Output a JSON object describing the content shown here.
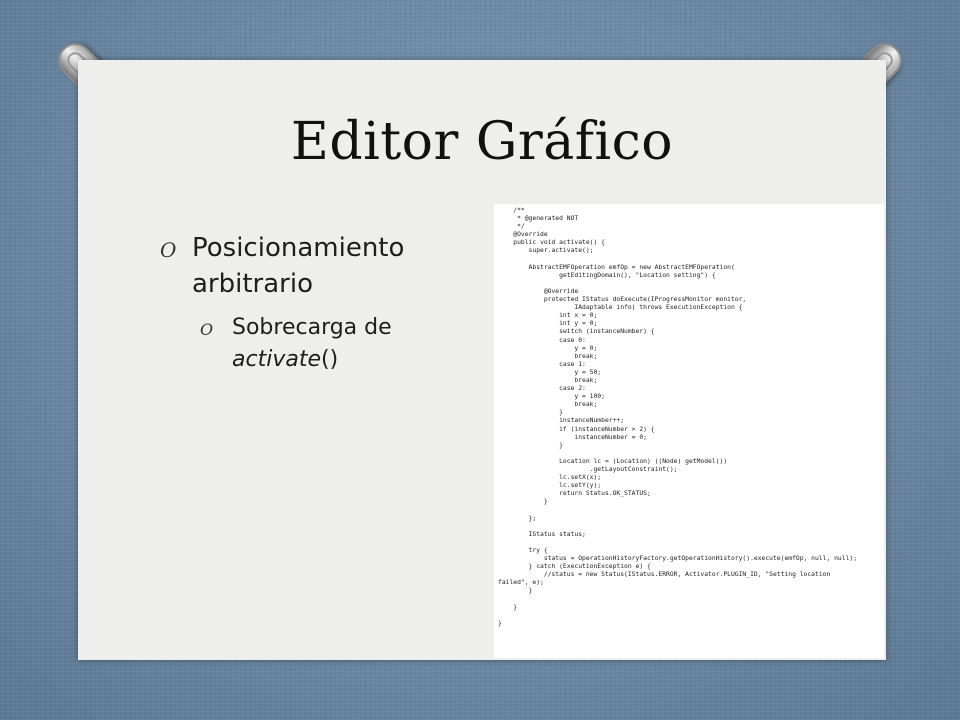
{
  "slide": {
    "title": "Editor Gráfico",
    "bullet_marker": "O",
    "bullets": [
      {
        "text": "Posicionamiento arbitrario"
      },
      {
        "prefix": "Sobrecarga de ",
        "emphasis": "activate",
        "suffix": "()"
      }
    ]
  },
  "code_screenshot": {
    "lines": [
      "    /**",
      "     * @generated NOT",
      "     */",
      "    @Override",
      "    public void activate() {",
      "        super.activate();",
      "",
      "        AbstractEMFOperation emfOp = new AbstractEMFOperation(",
      "                getEditingDomain(), \"Location setting\") {",
      "",
      "            @Override",
      "            protected IStatus doExecute(IProgressMonitor monitor,",
      "                    IAdaptable info) throws ExecutionException {",
      "                int x = 0;",
      "                int y = 0;",
      "                switch (instanceNumber) {",
      "                case 0:",
      "                    y = 0;",
      "                    break;",
      "                case 1:",
      "                    y = 50;",
      "                    break;",
      "                case 2:",
      "                    y = 100;",
      "                    break;",
      "                }",
      "                instanceNumber++;",
      "                if (instanceNumber > 2) {",
      "                    instanceNumber = 0;",
      "                }",
      "",
      "                Location lc = (Location) ((Node) getModel())",
      "                        .getLayoutConstraint();",
      "                lc.setX(x);",
      "                lc.setY(y);",
      "                return Status.OK_STATUS;",
      "            }",
      "",
      "        };",
      "",
      "        IStatus status;",
      "",
      "        try {",
      "            status = OperationHistoryFactory.getOperationHistory().execute(emfOp, null, null);",
      "        } catch (ExecutionException e) {",
      "            //status = new Status(IStatus.ERROR, Activator.PLUGIN_ID, \"Setting location",
      "failed\", e);",
      "        }",
      "",
      "    }",
      "",
      "}"
    ]
  }
}
